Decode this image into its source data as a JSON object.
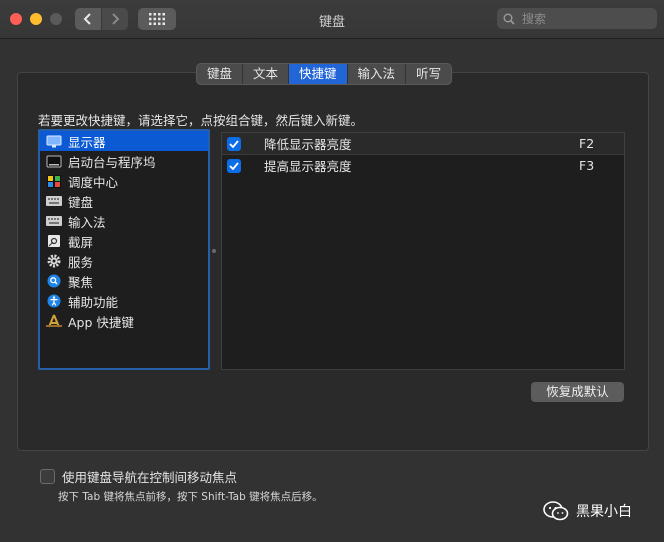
{
  "window": {
    "title": "键盘"
  },
  "search": {
    "placeholder": "搜索"
  },
  "tabs": [
    {
      "label": "键盘",
      "active": false
    },
    {
      "label": "文本",
      "active": false
    },
    {
      "label": "快捷键",
      "active": true
    },
    {
      "label": "输入法",
      "active": false
    },
    {
      "label": "听写",
      "active": false
    }
  ],
  "instruction": "若要更改快捷键，请选择它，点按组合键，然后键入新键。",
  "categories": [
    {
      "label": "显示器",
      "icon": "display-icon",
      "selected": true
    },
    {
      "label": "启动台与程序坞",
      "icon": "launchpad-dock-icon",
      "selected": false
    },
    {
      "label": "调度中心",
      "icon": "mission-control-icon",
      "selected": false
    },
    {
      "label": "键盘",
      "icon": "keyboard-icon",
      "selected": false
    },
    {
      "label": "输入法",
      "icon": "input-source-icon",
      "selected": false
    },
    {
      "label": "截屏",
      "icon": "screenshot-icon",
      "selected": false
    },
    {
      "label": "服务",
      "icon": "gear-icon",
      "selected": false
    },
    {
      "label": "聚焦",
      "icon": "spotlight-icon",
      "selected": false
    },
    {
      "label": "辅助功能",
      "icon": "accessibility-icon",
      "selected": false
    },
    {
      "label": "App 快捷键",
      "icon": "app-shortcuts-icon",
      "selected": false
    }
  ],
  "shortcuts": [
    {
      "label": "降低显示器亮度",
      "key": "F2",
      "checked": true
    },
    {
      "label": "提高显示器亮度",
      "key": "F3",
      "checked": true
    }
  ],
  "restore_button": "恢复成默认",
  "keyboard_navigation": {
    "label": "使用键盘导航在控制间移动焦点",
    "checked": false,
    "hint": "按下 Tab 键将焦点前移，按下 Shift-Tab 键将焦点后移。"
  },
  "watermark": "黑果小白",
  "colors": {
    "accent": "#0b5ad4",
    "checkbox": "#0b6ee6"
  }
}
